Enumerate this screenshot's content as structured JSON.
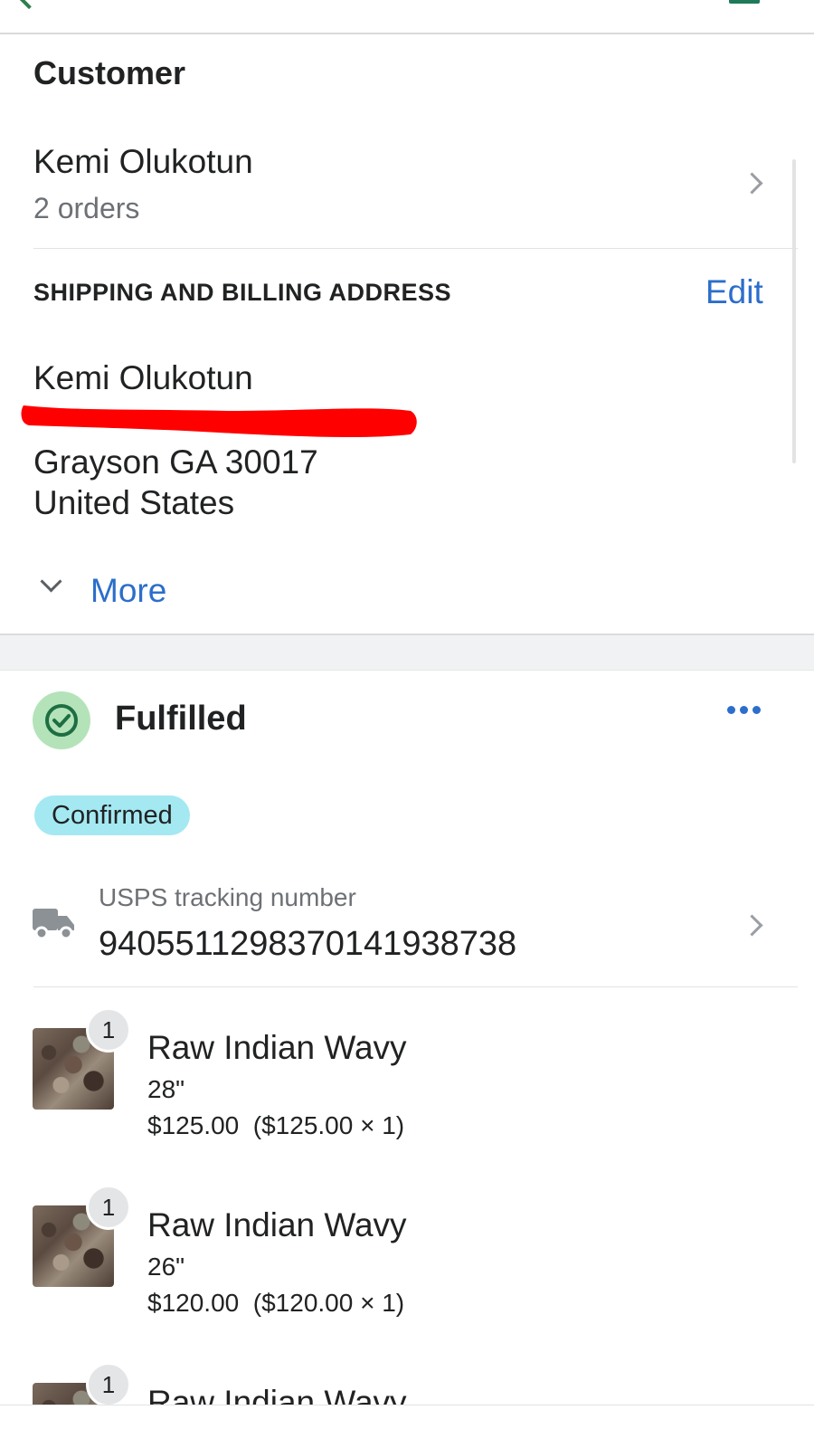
{
  "customer_section": {
    "title": "Customer",
    "name": "Kemi Olukotun",
    "orders": "2 orders"
  },
  "address_section": {
    "heading": "SHIPPING AND BILLING ADDRESS",
    "edit_label": "Edit",
    "name": "Kemi Olukotun",
    "city_line": "Grayson GA 30017",
    "country": "United States",
    "more_label": "More",
    "redaction_color": "#ff0000"
  },
  "fulfillment": {
    "title": "Fulfilled",
    "status_badge": "Confirmed",
    "tracking_label": "USPS tracking number",
    "tracking_number": "9405511298370141938738",
    "items": [
      {
        "quantity": "1",
        "title": "Raw Indian Wavy",
        "variant": "28\"",
        "price": "$125.00",
        "price_detail": "($125.00 × 1)"
      },
      {
        "quantity": "1",
        "title": "Raw Indian Wavy",
        "variant": "26\"",
        "price": "$120.00",
        "price_detail": "($120.00 × 1)"
      },
      {
        "quantity": "1",
        "title": "Raw Indian Wavy"
      }
    ]
  },
  "colors": {
    "accent": "#2c6ecb",
    "success": "#1f6e43",
    "badge_bg": "#a4e8f2"
  }
}
